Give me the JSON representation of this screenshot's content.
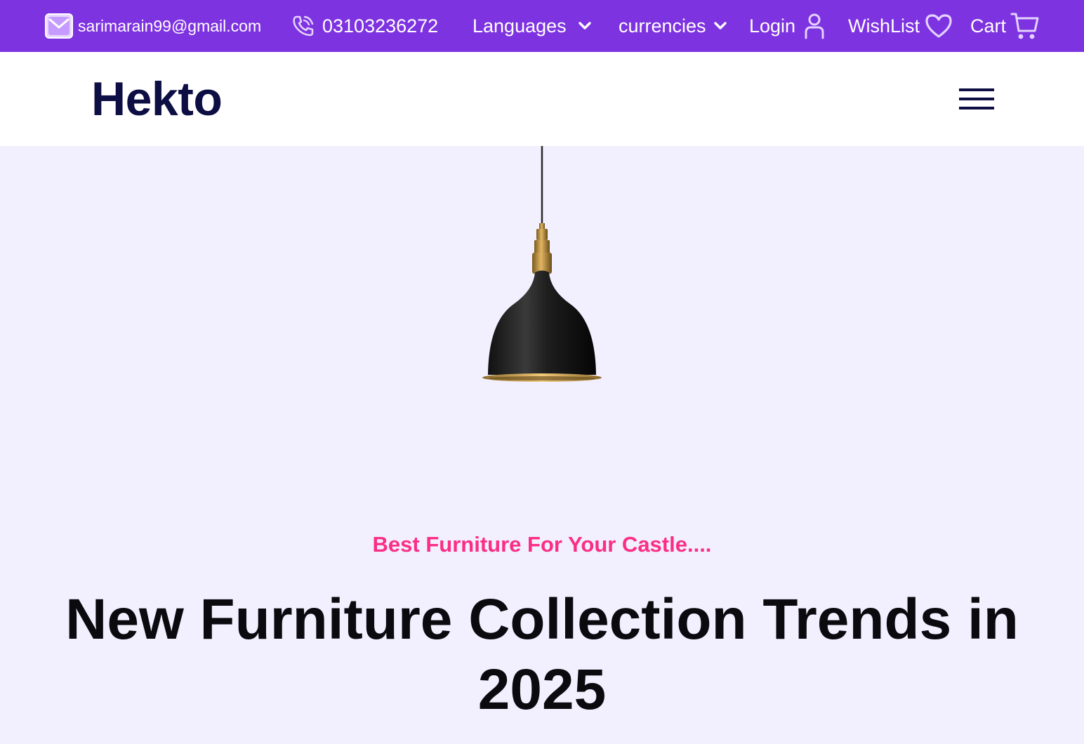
{
  "topbar": {
    "background": "#7E33E0",
    "email": "sarimarain99@gmail.com",
    "phone": "03103236272",
    "languages_label": "Languages",
    "currencies_label": "currencies",
    "login_label": "Login",
    "wishlist_label": "WishList",
    "cart_label": "Cart",
    "icons": [
      "mail-icon",
      "phone-icon",
      "chevron-down-icon",
      "user-icon",
      "heart-icon",
      "cart-icon"
    ]
  },
  "navbar": {
    "logo": "Hekto",
    "logo_color": "#0D0E43",
    "menu_icon": "hamburger-icon"
  },
  "hero": {
    "background": "#F2F0FF",
    "tagline": "Best Furniture For Your Castle....",
    "tagline_color": "#FB2E86",
    "headline": "New Furniture Collection Trends in 2025",
    "image": "pendant-lamp"
  }
}
